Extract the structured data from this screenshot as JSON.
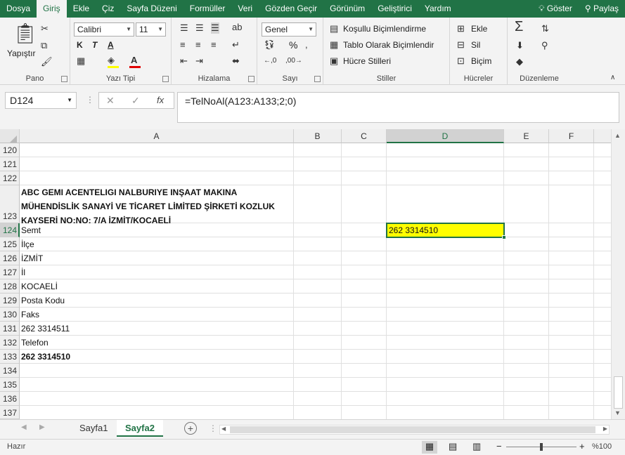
{
  "ribbon_tabs": [
    "Dosya",
    "Giriş",
    "Ekle",
    "Çiz",
    "Sayfa Düzeni",
    "Formüller",
    "Veri",
    "Gözden Geçir",
    "Görünüm",
    "Geliştirici",
    "Yardım"
  ],
  "ribbon_right": {
    "tell_me": "Göster",
    "share": "Paylaş"
  },
  "groups": {
    "pano": {
      "label": "Pano",
      "paste": "Yapıştır"
    },
    "font": {
      "label": "Yazı Tipi",
      "family": "Calibri",
      "size": "11",
      "bold": "K",
      "italic": "T",
      "underline": "A"
    },
    "align": {
      "label": "Hizalama"
    },
    "number": {
      "label": "Sayı",
      "format": "Genel",
      "percent": "%"
    },
    "styles": {
      "label": "Stiller",
      "conditional": "Koşullu Biçimlendirme",
      "table": "Tablo Olarak Biçimlendir",
      "cell_styles": "Hücre Stilleri"
    },
    "cells": {
      "label": "Hücreler",
      "insert": "Ekle",
      "delete": "Sil",
      "format": "Biçim"
    },
    "editing": {
      "label": "Düzenleme"
    }
  },
  "formula_bar": {
    "name_box": "D124",
    "formula": "=TelNoAl(A123:A133;2;0)",
    "fx": "fx"
  },
  "columns": [
    "A",
    "B",
    "C",
    "D",
    "E",
    "F"
  ],
  "selected_column": "D",
  "rows": [
    {
      "num": "120",
      "a": "",
      "bold": false
    },
    {
      "num": "121",
      "a": "",
      "bold": false
    },
    {
      "num": "122",
      "a": "",
      "bold": false
    },
    {
      "num": "123",
      "a_lines": [
        "ABC GEMI ACENTELIGI NALBURIYE INŞAAT MAKINA",
        "MÜHENDİSLİK SANAYİ VE TİCARET LİMİTED ŞİRKETİ KOZLUK",
        "KAYSERİ NO:NO: 7/A İZMİT/KOCAELİ"
      ],
      "bold": true
    },
    {
      "num": "124",
      "a": "Semt",
      "bold": false,
      "d": "262 3314510"
    },
    {
      "num": "125",
      "a": "İlçe",
      "bold": false
    },
    {
      "num": "126",
      "a": "İZMİT",
      "bold": false
    },
    {
      "num": "127",
      "a": "İl",
      "bold": false
    },
    {
      "num": "128",
      "a": "KOCAELİ",
      "bold": false
    },
    {
      "num": "129",
      "a": "Posta Kodu",
      "bold": false
    },
    {
      "num": "130",
      "a": "Faks",
      "bold": false
    },
    {
      "num": "131",
      "a": "262 3314511",
      "bold": false
    },
    {
      "num": "132",
      "a": "Telefon",
      "bold": false
    },
    {
      "num": "133",
      "a": "262 3314510",
      "bold": true
    },
    {
      "num": "134",
      "a": "",
      "bold": false
    },
    {
      "num": "135",
      "a": "",
      "bold": false
    },
    {
      "num": "136",
      "a": "",
      "bold": false
    },
    {
      "num": "137",
      "a": "",
      "bold": false
    }
  ],
  "selected_row": "124",
  "active_cell_fill": "#ffff00",
  "sheets": [
    "Sayfa1",
    "Sayfa2"
  ],
  "active_sheet": "Sayfa2",
  "status": {
    "mode": "Hazır",
    "zoom": "%100"
  },
  "colors": {
    "brand": "#217346"
  }
}
